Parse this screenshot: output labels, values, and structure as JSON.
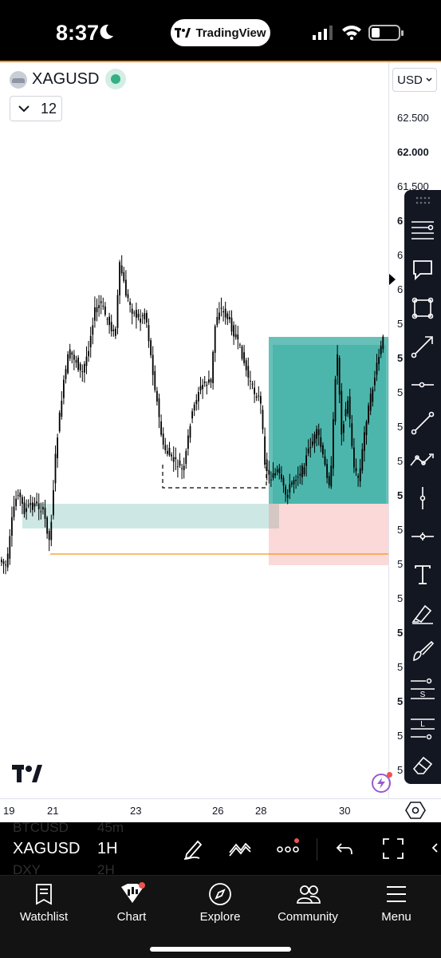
{
  "status_bar": {
    "time": "8:37",
    "app_pill": "TradingView"
  },
  "symbol": {
    "name": "XAGUSD",
    "indicator_count": "12",
    "status_color": "#35b083"
  },
  "price_axis": {
    "currency": "USD",
    "labels": [
      {
        "text": "62.500",
        "bold": false
      },
      {
        "text": "62.000",
        "bold": true
      },
      {
        "text": "61.500",
        "bold": false
      },
      {
        "text": "6",
        "bold": true
      },
      {
        "text": "6",
        "bold": false
      },
      {
        "text": "6",
        "bold": false
      },
      {
        "text": "5",
        "bold": false
      },
      {
        "text": "5",
        "bold": true
      },
      {
        "text": "5",
        "bold": false
      },
      {
        "text": "5",
        "bold": false
      },
      {
        "text": "5",
        "bold": false
      },
      {
        "text": "5",
        "bold": true
      },
      {
        "text": "5",
        "bold": false
      },
      {
        "text": "5",
        "bold": false
      },
      {
        "text": "5",
        "bold": false
      },
      {
        "text": "5",
        "bold": true
      },
      {
        "text": "5",
        "bold": false
      },
      {
        "text": "5",
        "bold": true
      },
      {
        "text": "5",
        "bold": false
      },
      {
        "text": "5",
        "bold": false
      }
    ],
    "tags": [
      {
        "text": "5",
        "color": "#26a69a"
      },
      {
        "text": "5",
        "color": "#787b86"
      },
      {
        "text": "5",
        "color": "#f7931a"
      },
      {
        "text": "5",
        "color": "#ef5350"
      }
    ]
  },
  "time_axis": {
    "labels": [
      "19",
      "21",
      "23",
      "26",
      "28",
      "30"
    ]
  },
  "chart_data": {
    "type": "candlestick",
    "title": "",
    "xlabel": "",
    "ylabel": "",
    "x_tick_labels": [
      "19",
      "21",
      "23",
      "26",
      "28",
      "30"
    ],
    "y_tick_labels": [
      "62.500",
      "62.000",
      "61.500"
    ],
    "grid": false,
    "position_tool": {
      "direction": "long"
    },
    "zones": [
      "demand zone",
      "previous low line"
    ],
    "colors": {
      "candle": "#000000",
      "profit": "#26a69a",
      "loss": "#ef5350",
      "demand": "#cde8e4",
      "line": "#f7931a"
    }
  },
  "drawing_tools": [
    "horizontal-lines-icon",
    "comment-icon",
    "rectangle-icon",
    "arrow-icon",
    "horizontal-ray-icon",
    "trend-line-icon",
    "path-icon",
    "vertical-line-icon",
    "cross-line-icon",
    "text-icon",
    "highlighter-icon",
    "brush-icon",
    "short-position-icon",
    "long-position-icon",
    "eraser-icon"
  ],
  "position_tool_labels": {
    "short": "S",
    "long": "L"
  },
  "bottom_toolbar": {
    "symbol": "XAGUSD",
    "interval": "1H",
    "ghost_prev": [
      "BTCUSD",
      "45m"
    ],
    "ghost_next": [
      "DXY",
      "2H"
    ]
  },
  "nav": [
    {
      "label": "Watchlist",
      "icon": "watchlist-icon"
    },
    {
      "label": "Chart",
      "icon": "chart-icon"
    },
    {
      "label": "Explore",
      "icon": "explore-icon"
    },
    {
      "label": "Community",
      "icon": "community-icon"
    },
    {
      "label": "Menu",
      "icon": "menu-icon"
    }
  ]
}
